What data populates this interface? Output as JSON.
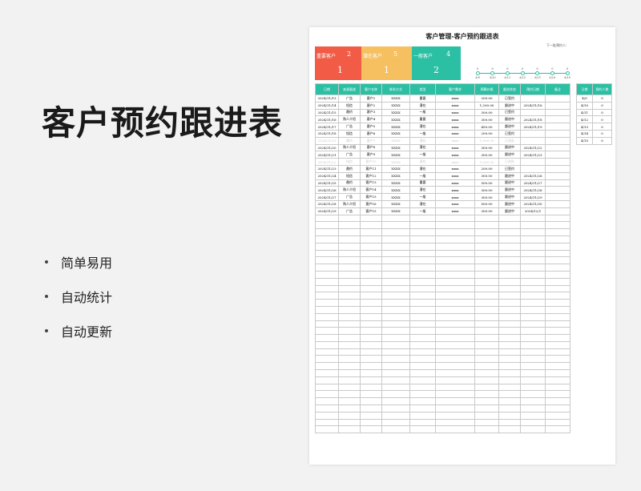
{
  "page": {
    "title": "客户预约跟进表",
    "features": [
      "简单易用",
      "自动统计",
      "自动更新"
    ]
  },
  "sheet": {
    "title": "客户管理-客户预约跟进表",
    "next_label": "下一批预约人:",
    "colors": {
      "red": "#f25c47",
      "yellow": "#f6c060",
      "green": "#2bbfa4"
    },
    "cards": [
      {
        "label": "重要客户",
        "count": "2",
        "value": "1"
      },
      {
        "label": "潜在客户",
        "count": "5",
        "value": "1"
      },
      {
        "label": "一般客户",
        "count": "4",
        "value": "2"
      }
    ],
    "timeline": [
      {
        "date": "4/9",
        "count": "0"
      },
      {
        "date": "4/10",
        "count": "0"
      },
      {
        "date": "4/11",
        "count": "0"
      },
      {
        "date": "4/12",
        "count": "0"
      },
      {
        "date": "4/13",
        "count": "0"
      },
      {
        "date": "4/14",
        "count": "0"
      },
      {
        "date": "4/15",
        "count": "0"
      }
    ],
    "columns": [
      "日期",
      "来源渠道",
      "客户名称",
      "联系方式",
      "类型",
      "客户需求",
      "预算价格",
      "跟进状态",
      "预约日期",
      "备注"
    ],
    "rows": [
      [
        "2024/11/13",
        "广告",
        "客户1",
        "XXXX",
        "重要",
        "xxxx",
        "200.00",
        "已签约",
        "",
        ""
      ],
      [
        "2024/11/14",
        "短信",
        "客户2",
        "XXXX",
        "潜在",
        "xxxx",
        "1,200.00",
        "跟进中",
        "2024/11/16",
        ""
      ],
      [
        "2024/11/15",
        "邀约",
        "客户3",
        "XXXX",
        "一般",
        "xxxx",
        "300.00",
        "已签约",
        "",
        ""
      ],
      [
        "2024/11/16",
        "熟人介绍",
        "客户4",
        "XXXX",
        "重要",
        "xxxx",
        "300.00",
        "跟进中",
        "2024/11/18",
        ""
      ],
      [
        "2024/11/17",
        "广告",
        "客户5",
        "XXXX",
        "潜在",
        "xxxx",
        "450.00",
        "跟进中",
        "2024/11/19",
        ""
      ],
      [
        "2024/11/18",
        "短信",
        "客户6",
        "XXXX",
        "一般",
        "xxxx",
        "200.00",
        "已签约",
        "",
        ""
      ],
      [
        "2024/11/19",
        "邀约",
        "客户7",
        "XXXX",
        "潜在",
        "xxxx",
        "1,000.00",
        "已流失",
        "",
        ""
      ],
      [
        "2024/11/20",
        "熟人介绍",
        "客户8",
        "XXXX",
        "潜在",
        "xxxx",
        "300.00",
        "跟进中",
        "2024/11/22",
        ""
      ],
      [
        "2024/11/21",
        "广告",
        "客户9",
        "XXXX",
        "一般",
        "xxxx",
        "300.00",
        "跟进中",
        "2024/11/23",
        ""
      ],
      [
        "2024/11/22",
        "短信",
        "客户10",
        "XXXX",
        "潜在",
        "xxxx",
        "1,000.00",
        "已流失",
        "",
        ""
      ],
      [
        "2024/11/23",
        "邀约",
        "客户11",
        "XXXX",
        "潜在",
        "xxxx",
        "200.00",
        "已签约",
        "",
        ""
      ],
      [
        "2024/11/24",
        "短信",
        "客户12",
        "XXXX",
        "一般",
        "xxxx",
        "300.00",
        "跟进中",
        "2024/11/26",
        ""
      ],
      [
        "2024/11/25",
        "邀约",
        "客户13",
        "XXXX",
        "重要",
        "xxxx",
        "500.00",
        "跟进中",
        "2024/11/27",
        ""
      ],
      [
        "2024/11/26",
        "熟人介绍",
        "客户14",
        "XXXX",
        "潜在",
        "xxxx",
        "300.00",
        "跟进中",
        "2024/11/28",
        ""
      ],
      [
        "2024/11/27",
        "广告",
        "客户15",
        "XXXX",
        "一般",
        "xxxx",
        "300.00",
        "跟进中",
        "2024/11/29",
        ""
      ],
      [
        "2024/11/28",
        "熟人介绍",
        "客户16",
        "XXXX",
        "潜在",
        "xxxx",
        "500.00",
        "跟进中",
        "2024/11/30",
        ""
      ],
      [
        "2024/11/29",
        "广告",
        "客户15",
        "XXXX",
        "一般",
        "xxxx",
        "300.00",
        "跟进中",
        "2024/12/1",
        ""
      ]
    ],
    "faded_rows": [
      6,
      9
    ],
    "empty_rows": 31,
    "side_columns": [
      "日期",
      "预约人数"
    ],
    "side_rows": [
      [
        "4/9",
        "0"
      ],
      [
        "4/10",
        "0"
      ],
      [
        "4/11",
        "0"
      ],
      [
        "4/12",
        "0"
      ],
      [
        "4/13",
        "0"
      ],
      [
        "4/14",
        "0"
      ],
      [
        "4/15",
        "0"
      ]
    ]
  }
}
